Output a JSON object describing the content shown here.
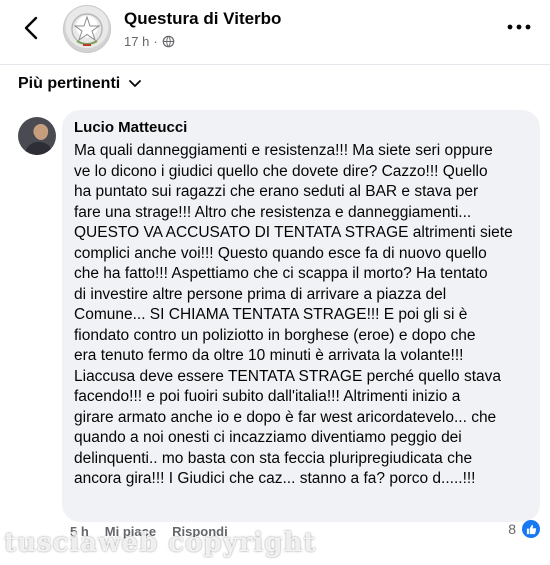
{
  "header": {
    "page_name": "Questura di Viterbo",
    "time": "17 h",
    "privacy_icon": "globe-icon"
  },
  "sort": {
    "label": "Più pertinenti"
  },
  "comment": {
    "author": "Lucio Matteucci",
    "lines": [
      "Ma quali danneggiamenti e resistenza!!! Ma siete seri oppure",
      "ve lo dicono i giudici quello che dovete dire? Cazzo!!! Quello",
      "ha puntato sui ragazzi che erano seduti al BAR e stava per",
      "fare una strage!!! Altro che resistenza e danneggiamenti...",
      "QUESTO VA ACCUSATO DI TENTATA STRAGE altrimenti siete",
      "complici anche voi!!! Questo quando esce fa di nuovo quello",
      "che ha fatto!!! Aspettiamo che ci scappa il morto? Ha tentato",
      "di investire altre persone prima di arrivare a piazza del",
      "Comune... SI CHIAMA TENTATA STRAGE!!! E poi gli si è",
      "fiondato contro un poliziotto in borghese (eroe) e dopo che",
      "era tenuto fermo da oltre 10 minuti è arrivata la volante!!!",
      "Liaccusa deve essere TENTATA STRAGE perché quello stava",
      "facendo!!! e poi fuoiri subito dall'italia!!! Altrimenti inizio a",
      "girare armato anche io e dopo è far west aricordatevelo... che",
      "quando a noi onesti ci incazziamo diventiamo peggio dei",
      "delinquenti.. mo basta con sta feccia pluripregiudicata che",
      "ancora gira!!! I Giudici che caz... stanno a fa? porco d.....!!!"
    ],
    "time": "5 h",
    "like_label": "Mi piace",
    "reply_label": "Rispondi",
    "reaction_count": "8"
  },
  "watermark": "tusciaweb copyright",
  "colors": {
    "accent": "#1877f2",
    "bubble": "#f0f2f5",
    "muted": "#65676b"
  }
}
